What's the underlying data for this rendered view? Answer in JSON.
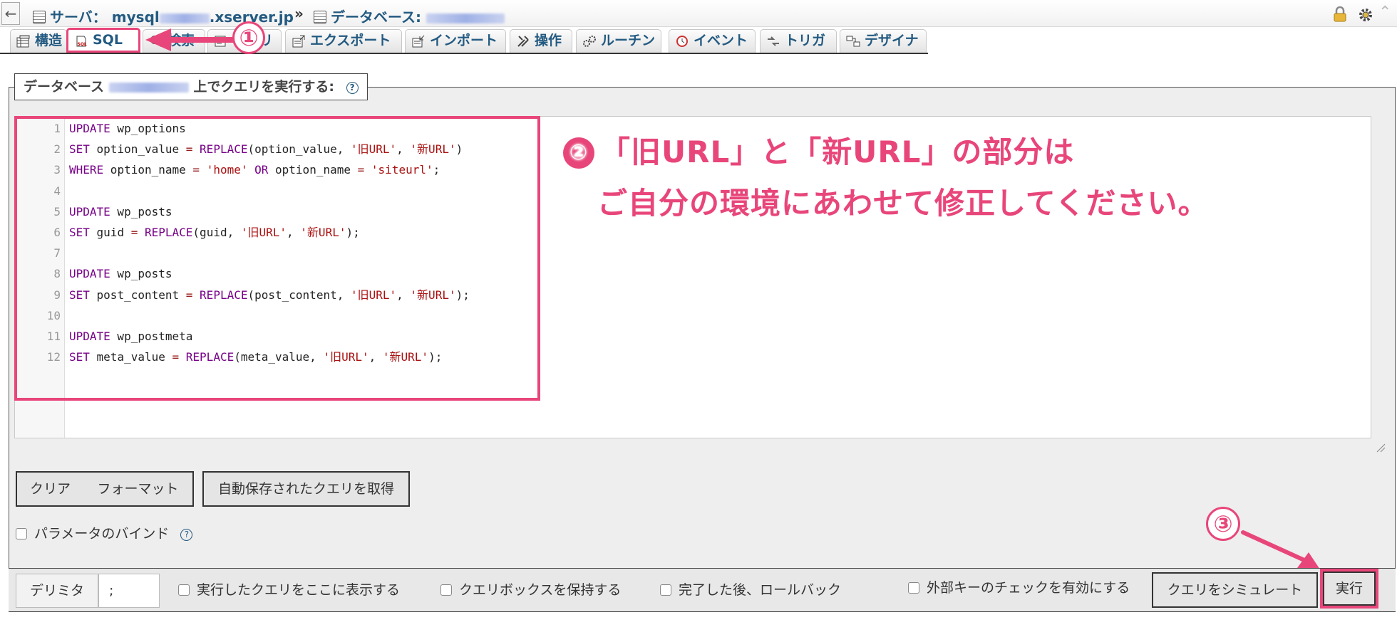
{
  "breadcrumb": {
    "back": "←",
    "server_label": "サーバ：",
    "server_prefix": "mysql",
    "server_suffix": ".xserver.jp",
    "separator": "»",
    "database_label": "データベース:"
  },
  "tabs": [
    {
      "label": "構造",
      "icon": "structure-icon"
    },
    {
      "label": "SQL",
      "icon": "sql-icon"
    },
    {
      "label": "検索",
      "icon": "search-icon"
    },
    {
      "label": "クエリ",
      "icon": "query-icon"
    },
    {
      "label": "エクスポート",
      "icon": "export-icon"
    },
    {
      "label": "インポート",
      "icon": "import-icon"
    },
    {
      "label": "操作",
      "icon": "wrench-icon"
    },
    {
      "label": "ルーチン",
      "icon": "routines-icon"
    },
    {
      "label": "イベント",
      "icon": "clock-icon"
    },
    {
      "label": "トリガ",
      "icon": "trigger-icon"
    },
    {
      "label": "デザイナ",
      "icon": "designer-icon"
    }
  ],
  "panel": {
    "legend_prefix": "データベース",
    "legend_suffix": "上でクエリを実行する:",
    "help": "?"
  },
  "editor": {
    "lines": [
      {
        "n": "1",
        "text": "UPDATE wp_options"
      },
      {
        "n": "2",
        "text": "SET option_value = REPLACE(option_value, '旧URL', '新URL')"
      },
      {
        "n": "3",
        "text": "WHERE option_name = 'home' OR option_name = 'siteurl';"
      },
      {
        "n": "4",
        "text": ""
      },
      {
        "n": "5",
        "text": "UPDATE wp_posts"
      },
      {
        "n": "6",
        "text": "SET guid = REPLACE(guid, '旧URL', '新URL');"
      },
      {
        "n": "7",
        "text": ""
      },
      {
        "n": "8",
        "text": "UPDATE wp_posts"
      },
      {
        "n": "9",
        "text": "SET post_content = REPLACE(post_content, '旧URL', '新URL');"
      },
      {
        "n": "10",
        "text": ""
      },
      {
        "n": "11",
        "text": "UPDATE wp_postmeta"
      },
      {
        "n": "12",
        "text": "SET meta_value = REPLACE(meta_value, '旧URL', '新URL');"
      }
    ]
  },
  "annotation": {
    "step1": "①",
    "step2": "②",
    "step3": "③",
    "note_line1": "「旧URL」と「新URL」の部分は",
    "note_line2": "ご自分の環境にあわせて修正してください。",
    "color": "#e8467a"
  },
  "buttons": {
    "clear": "クリア",
    "format": "フォーマット",
    "autosaved": "自動保存されたクエリを取得",
    "simulate": "クエリをシミュレート",
    "execute": "実行"
  },
  "options": {
    "bind_params": "パラメータのバインド",
    "delimiter_label": "デリミタ",
    "delimiter_value": ";",
    "show_query": "実行したクエリをここに表示する",
    "retain_box": "クエリボックスを保持する",
    "rollback": "完了した後、ロールバック",
    "fk_check": "外部キーのチェックを有効にする"
  }
}
